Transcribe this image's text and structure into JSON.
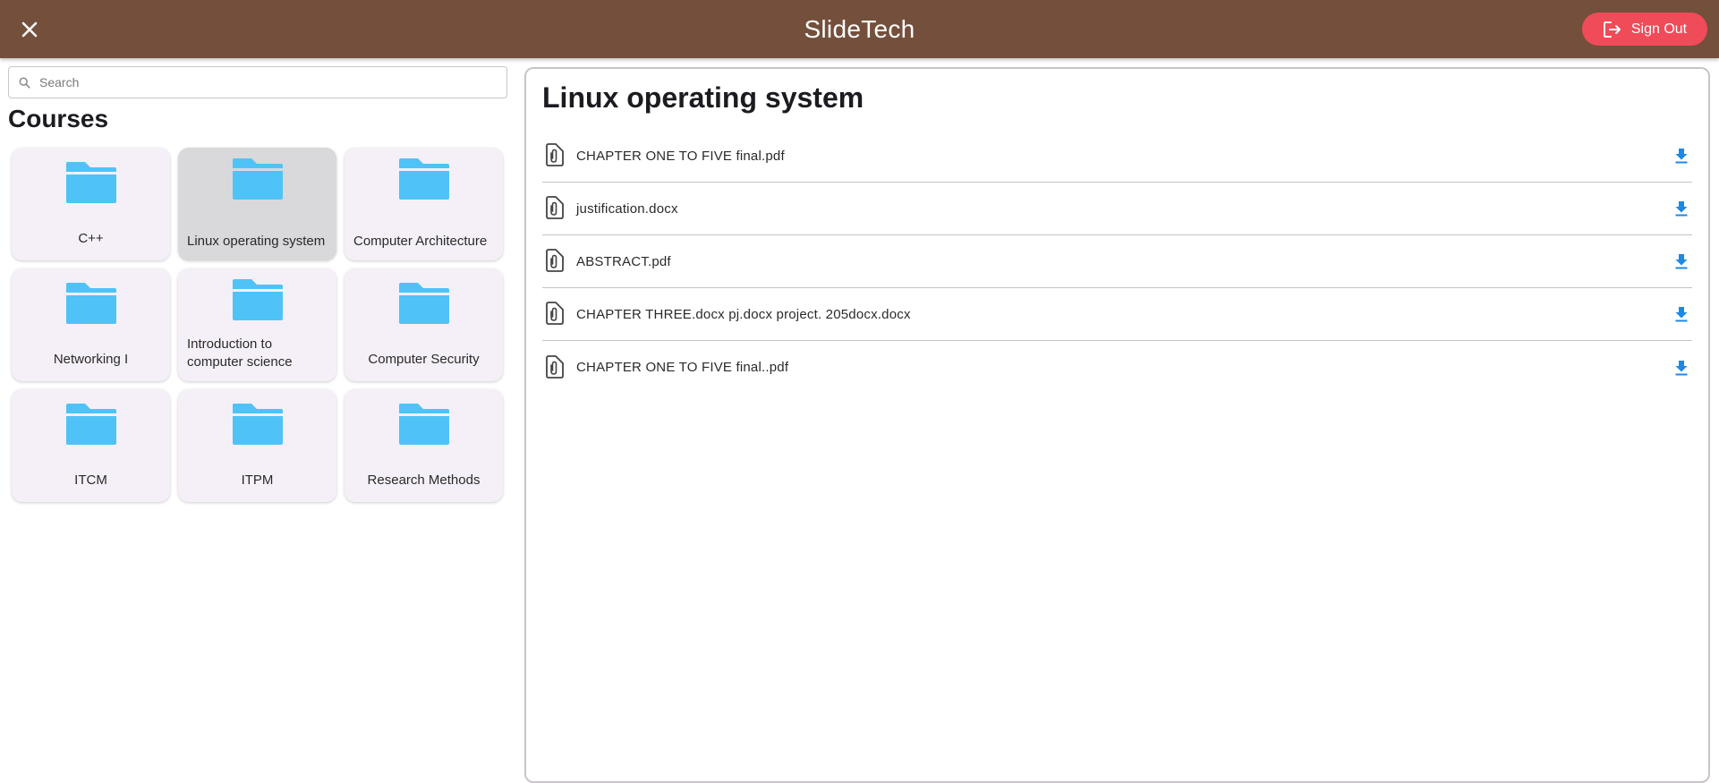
{
  "app_bar": {
    "title": "SlideTech",
    "close_icon": "close-icon",
    "sign_out_label": "Sign Out",
    "sign_out_icon": "logout-icon",
    "background_color": "#744f3b",
    "sign_out_color": "#ef4b59"
  },
  "sidebar": {
    "search": {
      "placeholder": "Search",
      "value": ""
    },
    "section_title": "Courses",
    "folder_color": "#4fc3f7",
    "courses": [
      {
        "label": "C++",
        "selected": false
      },
      {
        "label": "Linux operating system",
        "selected": true
      },
      {
        "label": "Computer Architecture",
        "selected": false
      },
      {
        "label": "Networking I",
        "selected": false
      },
      {
        "label": "Introduction to computer science",
        "selected": false
      },
      {
        "label": "Computer Security",
        "selected": false
      },
      {
        "label": "ITCM",
        "selected": false
      },
      {
        "label": "ITPM",
        "selected": false
      },
      {
        "label": "Research Methods",
        "selected": false
      }
    ]
  },
  "content": {
    "title": "Linux operating system",
    "accent_color": "#1e88e5",
    "files": [
      {
        "name": "CHAPTER ONE TO FIVE final.pdf",
        "icon": "attachment-file-icon",
        "action_icon": "download-icon"
      },
      {
        "name": "justification.docx",
        "icon": "attachment-file-icon",
        "action_icon": "download-icon"
      },
      {
        "name": "ABSTRACT.pdf",
        "icon": "attachment-file-icon",
        "action_icon": "download-icon"
      },
      {
        "name": "CHAPTER THREE.docx pj.docx project. 205docx.docx",
        "icon": "attachment-file-icon",
        "action_icon": "download-icon"
      },
      {
        "name": "CHAPTER ONE TO FIVE final..pdf",
        "icon": "attachment-file-icon",
        "action_icon": "download-icon"
      }
    ]
  }
}
